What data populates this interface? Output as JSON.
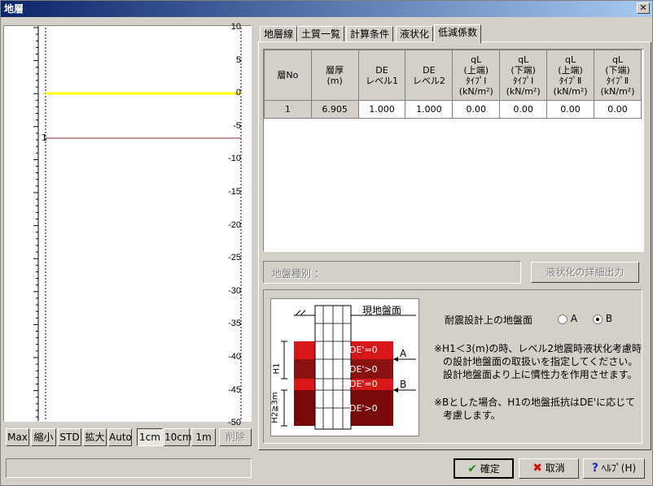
{
  "window": {
    "title": "地層",
    "close_glyph": "✕"
  },
  "plot": {
    "y_ticks": [
      "10",
      "5",
      "0",
      "-5",
      "-10",
      "-15",
      "-20",
      "-25",
      "-30",
      "-35",
      "-40",
      "-45",
      "-50"
    ],
    "layer_marker": "1",
    "colors": {
      "ground_line": "#ffff00",
      "layer_line": "#8b2e2e"
    }
  },
  "left_buttons": {
    "max": "Max",
    "shrink": "縮小",
    "std": "STD",
    "enlarge": "拡大",
    "auto": "Auto",
    "cm1": "1cm",
    "cm10": "10cm",
    "m1": "1m",
    "delete": "削除"
  },
  "tabs": [
    "地層線",
    "土質一覧",
    "計算条件",
    "液状化",
    "低減係数"
  ],
  "table": {
    "headers": [
      [
        "層No"
      ],
      [
        "層厚",
        "(m)"
      ],
      [
        "DE",
        "レベル1"
      ],
      [
        "DE",
        "レベル2"
      ],
      [
        "qL",
        "(上端)",
        "ﾀｲﾌﾟⅠ",
        "(kN/m²)"
      ],
      [
        "qL",
        "(下端)",
        "ﾀｲﾌﾟⅠ",
        "(kN/m²)"
      ],
      [
        "qL",
        "(上端)",
        "ﾀｲﾌﾟⅡ",
        "(kN/m²)"
      ],
      [
        "qL",
        "(下端)",
        "ﾀｲﾌﾟⅡ",
        "(kN/m²)"
      ]
    ],
    "rows": [
      [
        "1",
        "6.905",
        "1.000",
        "1.000",
        "0.00",
        "0.00",
        "0.00",
        "0.00"
      ]
    ]
  },
  "ground_type_label": "地盤種別 ：",
  "liq_detail_button": "液状化の詳細出力",
  "diagram": {
    "ground_label": "現地盤面",
    "layers": [
      "DE'=0",
      "DE'>0",
      "DE'=0",
      "DE'>0"
    ],
    "label_a": "A",
    "label_b": "B",
    "h1": "H1",
    "h2": "H2≧3m"
  },
  "design_surface": {
    "label": "耐震設計上の地盤面",
    "option_a": "A",
    "option_b": "B",
    "selected": "B"
  },
  "notes": [
    "※H1＜3(m)の時、レベル2地震時液状化考慮時",
    "の設計地盤面の取扱いを指定してください。",
    "設計地盤面より上に慣性力を作用させます。",
    "※Bとした場合、H1の地盤抵抗はDE'に応じて",
    "考慮します。"
  ],
  "buttons": {
    "ok": "確定",
    "cancel": "取消",
    "help": "ﾍﾙﾌﾟ(H)"
  }
}
